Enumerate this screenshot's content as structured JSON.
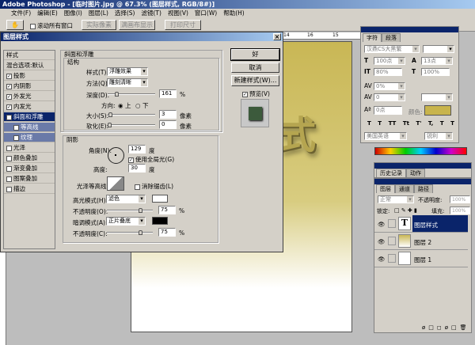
{
  "app": {
    "title": "Adobe Photoshop - [临时图片.jpg @ 67.3% (图层样式, RGB/8#)]"
  },
  "menu": [
    "文件(F)",
    "编辑(E)",
    "图像(I)",
    "图层(L)",
    "选择(S)",
    "滤镜(T)",
    "视图(V)",
    "窗口(W)",
    "帮助(H)"
  ],
  "options": {
    "scroll_all": "滚动所有窗口",
    "b1": "实际像素",
    "b2": "满画布显示",
    "b3": "打印尺寸"
  },
  "ruler": [
    "14",
    "16",
    "15"
  ],
  "dialog": {
    "title": "图层样式",
    "styles": [
      {
        "label": "样式",
        "checked": null
      },
      {
        "label": "混合选项:默认",
        "checked": null
      },
      {
        "label": "投影",
        "checked": true
      },
      {
        "label": "内阴影",
        "checked": true
      },
      {
        "label": "外发光",
        "checked": true
      },
      {
        "label": "内发光",
        "checked": true
      },
      {
        "label": "斜面和浮雕",
        "checked": true,
        "selected": true
      },
      {
        "label": "等高线",
        "checked": false,
        "sub": true
      },
      {
        "label": "纹理",
        "checked": false,
        "sub": true
      },
      {
        "label": "光泽",
        "checked": false
      },
      {
        "label": "颜色叠加",
        "checked": false
      },
      {
        "label": "渐变叠加",
        "checked": false
      },
      {
        "label": "图案叠加",
        "checked": false
      },
      {
        "label": "描边",
        "checked": false
      }
    ],
    "bevel": {
      "title": "斜面和浮雕",
      "structure": "结构",
      "style_label": "样式(T):",
      "style": "浮雕效果",
      "technique_label": "方法(Q):",
      "technique": "雕刻清晰",
      "depth_label": "深度(D):",
      "depth": "161",
      "depth_unit": "%",
      "depth_pct": 0.16,
      "direction_label": "方向:",
      "up": "上",
      "down": "下",
      "size_label": "大小(S):",
      "size": "3",
      "size_unit": "像素",
      "size_pct": 0.02,
      "soften_label": "软化(E):",
      "soften": "0",
      "soften_unit": "像素",
      "soften_pct": 0
    },
    "shading": {
      "title": "阴影",
      "angle_label": "角度(N):",
      "angle": "129",
      "angle_unit": "度",
      "global_light": "使用全局光(G)",
      "altitude_label": "高度:",
      "altitude": "30",
      "altitude_unit": "度",
      "gloss_label": "光泽等高线:",
      "antialias": "消除锯齿(L)",
      "highlight_label": "高光模式(H):",
      "highlight_mode": "滤色",
      "highlight_color": "#ffffff",
      "hopacity_label": "不透明度(O):",
      "hopacity": "75",
      "hopacity_unit": "%",
      "hopacity_pct": 0.75,
      "shadow_label": "暗调模式(A):",
      "shadow_mode": "正片叠底",
      "shadow_color": "#000000",
      "sopacity_label": "不透明度(C):",
      "sopacity": "75",
      "sopacity_unit": "%",
      "sopacity_pct": 0.75
    },
    "ok": "好",
    "cancel": "取消",
    "new_style": "新建样式(W)...",
    "preview": "预览(V)"
  },
  "canvas": {
    "text": "式",
    "top_color": "#c9b755",
    "bottom_color": "#ffffff"
  },
  "character": {
    "tabs": [
      "字符",
      "段落"
    ],
    "font": "汉鼎CS大黑繁",
    "size": "100点",
    "leading": "13点",
    "vscale": "80%",
    "hscale": "100%",
    "tracking": "0%",
    "kerning": "0",
    "baseline": "0点",
    "color_label": "颜色:",
    "color": "#c8b44c",
    "language": "美国英语",
    "aa": "锐利",
    "styles": [
      "T",
      "T",
      "TT",
      "Tt",
      "T'",
      "T,",
      "T",
      "T"
    ]
  },
  "history": {
    "tabs": [
      "历史记录",
      "动作"
    ]
  },
  "layers": {
    "tabs": [
      "图层",
      "通道",
      "路径"
    ],
    "blend": "正常",
    "opacity_label": "不透明度:",
    "opacity": "100%",
    "lock_label": "锁定:",
    "fill_label": "填充:",
    "fill": "100%",
    "items": [
      {
        "name": "图层样式",
        "type": "text",
        "selected": true
      },
      {
        "name": "图层 2",
        "type": "image",
        "selected": false
      },
      {
        "name": "图层 1",
        "type": "image",
        "selected": false
      }
    ]
  }
}
